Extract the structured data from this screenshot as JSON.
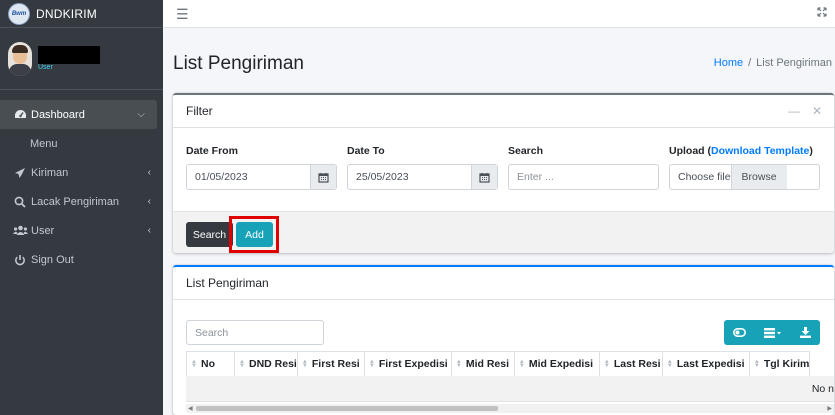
{
  "brand": {
    "logo_text": "Bwm",
    "name": "DNDKIRIM"
  },
  "user": {
    "role": "User"
  },
  "sidebar": {
    "items": [
      {
        "label": "Dashboard",
        "icon": "tachometer-icon"
      },
      {
        "label": "Menu"
      },
      {
        "label": "Kiriman",
        "icon": "paper-plane-icon"
      },
      {
        "label": "Lacak Pengiriman",
        "icon": "search-icon"
      },
      {
        "label": "User",
        "icon": "users-icon"
      },
      {
        "label": "Sign Out",
        "icon": "power-icon"
      }
    ]
  },
  "header": {
    "title": "List Pengiriman",
    "breadcrumb": {
      "home": "Home",
      "separator": "/",
      "current": "List Pengiriman"
    }
  },
  "filter_card": {
    "title": "Filter",
    "date_from": {
      "label": "Date From",
      "value": "01/05/2023"
    },
    "date_to": {
      "label": "Date To",
      "value": "25/05/2023"
    },
    "search": {
      "label": "Search",
      "placeholder": "Enter ..."
    },
    "upload": {
      "label_prefix": "Upload (",
      "link": "Download Template",
      "label_suffix": ")",
      "placeholder": "Choose file",
      "browse": "Browse"
    },
    "search_button": "Search",
    "add_button": "Add"
  },
  "list_card": {
    "title": "List Pengiriman",
    "search_placeholder": "Search",
    "columns": [
      "No",
      "DND Resi",
      "First Resi",
      "First Expedisi",
      "Mid Resi",
      "Mid Expedisi",
      "Last Resi",
      "Last Expedisi",
      "Tgl Kirim"
    ],
    "empty_text": "No n"
  },
  "colors": {
    "sidebar_bg": "#343a40",
    "accent_info": "#17a2b8",
    "link": "#007bff",
    "highlight": "#e00000"
  }
}
